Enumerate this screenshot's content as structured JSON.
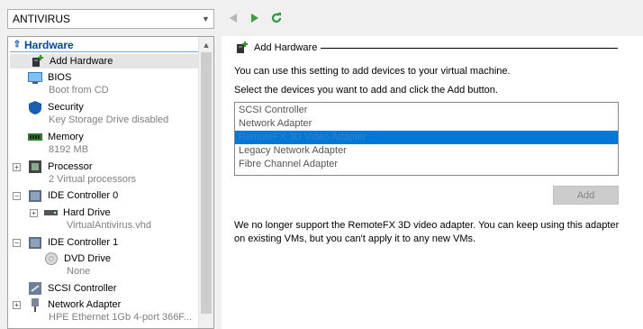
{
  "vm_selector": {
    "value": "ANTIVIRUS"
  },
  "tree": {
    "section": "Hardware",
    "items": [
      {
        "label": "Add Hardware"
      },
      {
        "label": "BIOS",
        "sub": "Boot from CD"
      },
      {
        "label": "Security",
        "sub": "Key Storage Drive disabled"
      },
      {
        "label": "Memory",
        "sub": "8192 MB"
      },
      {
        "label": "Processor",
        "sub": "2 Virtual processors"
      },
      {
        "label": "IDE Controller 0"
      },
      {
        "label": "Hard Drive",
        "sub": "VirtualAntivirus.vhd"
      },
      {
        "label": "IDE Controller 1"
      },
      {
        "label": "DVD Drive",
        "sub": "None"
      },
      {
        "label": "SCSI Controller"
      },
      {
        "label": "Network Adapter",
        "sub": "HPE Ethernet 1Gb 4-port 366F..."
      }
    ]
  },
  "panel": {
    "title": "Add Hardware",
    "intro": "You can use this setting to add devices to your virtual machine.",
    "instruction": "Select the devices you want to add and click the Add button.",
    "devices": [
      "SCSI Controller",
      "Network Adapter",
      "RemoteFX 3D Video Adapter",
      "Legacy Network Adapter",
      "Fibre Channel Adapter"
    ],
    "selected_device": "RemoteFX 3D Video Adapter",
    "add_button": "Add",
    "note": "We no longer support the RemoteFX 3D video adapter. You can keep using this adapter on existing VMs, but you can't apply it to any new VMs."
  },
  "colors": {
    "accent": "#0078d7",
    "section": "#0046b0",
    "play": "#3aa335"
  }
}
